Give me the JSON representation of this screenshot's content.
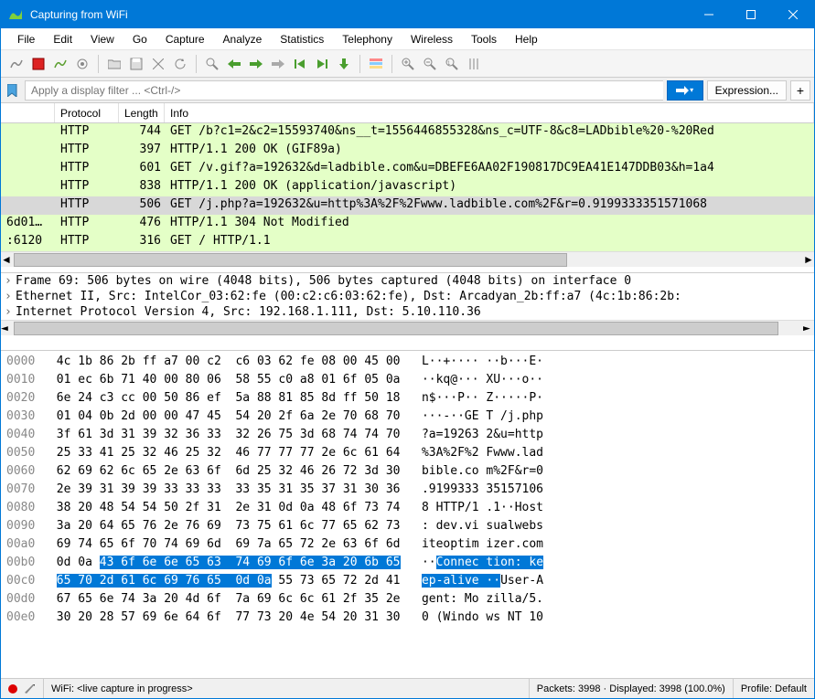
{
  "title": "Capturing from WiFi",
  "menus": [
    "File",
    "Edit",
    "View",
    "Go",
    "Capture",
    "Analyze",
    "Statistics",
    "Telephony",
    "Wireless",
    "Tools",
    "Help"
  ],
  "filter_placeholder": "Apply a display filter ... <Ctrl-/>",
  "expression_label": "Expression...",
  "plus_label": "+",
  "packet_headers": {
    "dst": "",
    "protocol": "Protocol",
    "length": "Length",
    "info": "Info"
  },
  "packets": [
    {
      "dst": "",
      "proto": "HTTP",
      "len": "744",
      "info": "GET /b?c1=2&c2=15593740&ns__t=1556446855328&ns_c=UTF-8&c8=LADbible%20-%20Red",
      "cls": "green"
    },
    {
      "dst": "",
      "proto": "HTTP",
      "len": "397",
      "info": "HTTP/1.1 200 OK  (GIF89a)",
      "cls": "green"
    },
    {
      "dst": "",
      "proto": "HTTP",
      "len": "601",
      "info": "GET /v.gif?a=192632&d=ladbible.com&u=DBEFE6AA02F190817DC9EA41E147DDB03&h=1a4",
      "cls": "green"
    },
    {
      "dst": "",
      "proto": "HTTP",
      "len": "838",
      "info": "HTTP/1.1 200 OK  (application/javascript)",
      "cls": "green"
    },
    {
      "dst": "",
      "proto": "HTTP",
      "len": "506",
      "info": "GET /j.php?a=192632&u=http%3A%2F%2Fwww.ladbible.com%2F&r=0.9199333351571068",
      "cls": "sel"
    },
    {
      "dst": "6d01…",
      "proto": "HTTP",
      "len": "476",
      "info": "HTTP/1.1 304 Not Modified",
      "cls": "green"
    },
    {
      "dst": ":6120",
      "proto": "HTTP",
      "len": "316",
      "info": "GET / HTTP/1.1",
      "cls": "green"
    }
  ],
  "details": [
    "Frame 69: 506 bytes on wire (4048 bits), 506 bytes captured (4048 bits) on interface 0",
    "Ethernet II, Src: IntelCor_03:62:fe (00:c2:c6:03:62:fe), Dst: Arcadyan_2b:ff:a7 (4c:1b:86:2b:",
    "Internet Protocol Version 4, Src: 192.168.1.111, Dst: 5.10.110.36"
  ],
  "hex_rows": [
    {
      "off": "0000",
      "hex": "4c 1b 86 2b ff a7 00 c2  c6 03 62 fe 08 00 45 00",
      "asc": "L··+···· ··b···E·"
    },
    {
      "off": "0010",
      "hex": "01 ec 6b 71 40 00 80 06  58 55 c0 a8 01 6f 05 0a",
      "asc": "··kq@··· XU···o··"
    },
    {
      "off": "0020",
      "hex": "6e 24 c3 cc 00 50 86 ef  5a 88 81 85 8d ff 50 18",
      "asc": "n$···P·· Z·····P·"
    },
    {
      "off": "0030",
      "hex": "01 04 0b 2d 00 00 47 45  54 20 2f 6a 2e 70 68 70",
      "asc": "···-··GE T /j.php"
    },
    {
      "off": "0040",
      "hex": "3f 61 3d 31 39 32 36 33  32 26 75 3d 68 74 74 70",
      "asc": "?a=19263 2&u=http"
    },
    {
      "off": "0050",
      "hex": "25 33 41 25 32 46 25 32  46 77 77 77 2e 6c 61 64",
      "asc": "%3A%2F%2 Fwww.lad"
    },
    {
      "off": "0060",
      "hex": "62 69 62 6c 65 2e 63 6f  6d 25 32 46 26 72 3d 30",
      "asc": "bible.co m%2F&r=0"
    },
    {
      "off": "0070",
      "hex": "2e 39 31 39 39 33 33 33  33 35 31 35 37 31 30 36",
      "asc": ".9199333 35157106"
    },
    {
      "off": "0080",
      "hex": "38 20 48 54 54 50 2f 31  2e 31 0d 0a 48 6f 73 74",
      "asc": "8 HTTP/1 .1··Host"
    },
    {
      "off": "0090",
      "hex": "3a 20 64 65 76 2e 76 69  73 75 61 6c 77 65 62 73",
      "asc": ": dev.vi sualwebs"
    },
    {
      "off": "00a0",
      "hex": "69 74 65 6f 70 74 69 6d  69 7a 65 72 2e 63 6f 6d",
      "asc": "iteoptim izer.com"
    }
  ],
  "hex_hl1": {
    "off": "00b0",
    "pre": "0d 0a ",
    "hl": "43 6f 6e 6e 65 63  74 69 6f 6e 3a 20 6b 65",
    "asc_pre": "··",
    "asc_hl": "Connec tion: ke"
  },
  "hex_hl2": {
    "off": "00c0",
    "hl": "65 70 2d 61 6c 69 76 65  0d 0a",
    "post": " 55 73 65 72 2d 41",
    "asc_hl": "ep-alive ··",
    "asc_post": "User-A"
  },
  "hex_rows2": [
    {
      "off": "00d0",
      "hex": "67 65 6e 74 3a 20 4d 6f  7a 69 6c 6c 61 2f 35 2e",
      "asc": "gent: Mo zilla/5."
    },
    {
      "off": "00e0",
      "hex": "30 20 28 57 69 6e 64 6f  77 73 20 4e 54 20 31 30",
      "asc": "0 (Windo ws NT 10"
    }
  ],
  "status": {
    "capture": "WiFi: <live capture in progress>",
    "packets": "Packets: 3998 · Displayed: 3998 (100.0%)",
    "profile": "Profile: Default"
  }
}
